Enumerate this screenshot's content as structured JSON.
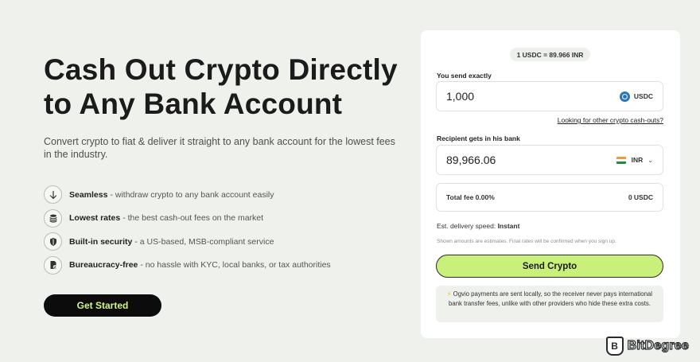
{
  "hero": {
    "title_line1": "Cash Out Crypto Directly",
    "title_line2": "to Any Bank Account",
    "subtitle": "Convert crypto to fiat & deliver it straight to any bank account for the lowest fees in the industry."
  },
  "features": [
    {
      "icon": "arrow-down-icon",
      "title": "Seamless",
      "text": "- withdraw crypto to any bank account easily"
    },
    {
      "icon": "coins-icon",
      "title": "Lowest rates",
      "text": "- the best cash-out fees on the market"
    },
    {
      "icon": "shield-icon",
      "title": "Built-in security",
      "text": "- a US-based, MSB-compliant service"
    },
    {
      "icon": "document-icon",
      "title": "Bureaucracy-free",
      "text": "- no hassle with KYC, local banks, or tax authorities"
    }
  ],
  "cta": {
    "label": "Get Started"
  },
  "widget": {
    "rate": "1 USDC = 89.966 INR",
    "send_label": "You send exactly",
    "send_amount": "1,000",
    "send_currency": "USDC",
    "other_link": "Looking for other crypto cash-outs?",
    "receive_label": "Recipient gets in his bank",
    "receive_amount": "89,966.06",
    "receive_currency": "INR",
    "fee_label": "Total fee 0.00%",
    "fee_value": "0 USDC",
    "delivery_label": "Est. delivery speed:",
    "delivery_value": "Instant",
    "disclaimer": "Shown amounts are estimates. Final rates will be confirmed when you sign up.",
    "send_button": "Send Crypto",
    "info_text": "Ogvio payments are sent locally, so the receiver never pays international bank transfer fees, unlike with other providers who hide these extra costs."
  },
  "brand": {
    "name": "BitDegree",
    "logo_letter": "B"
  },
  "colors": {
    "accent": "#c8f07a",
    "cta_text": "#d4f58a",
    "background": "#eef1ec"
  }
}
